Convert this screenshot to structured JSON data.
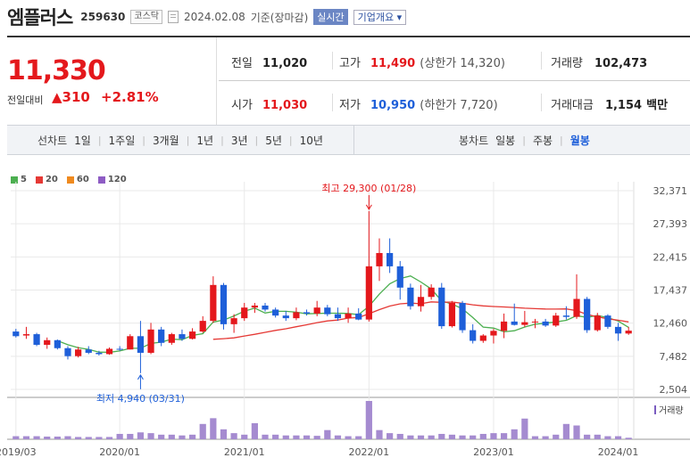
{
  "header": {
    "title": "엠플러스",
    "code": "259630",
    "market": "코스닥",
    "date": "2024.02.08",
    "basis": "기준(장마감)",
    "live_btn": "실시간",
    "info_btn": "기업개요 ▾"
  },
  "quote": {
    "price": "11,330",
    "change_label": "전일대비",
    "change": "▲310",
    "change_pct": "+2.81%",
    "prev_label": "전일",
    "prev": "11,020",
    "open_label": "시가",
    "open": "11,030",
    "high_label": "고가",
    "high": "11,490",
    "upper_limit": "(상한가 14,320)",
    "low_label": "저가",
    "low": "10,950",
    "lower_limit": "(하한가 7,720)",
    "volume_label": "거래량",
    "volume": "102,473",
    "amount_label": "거래대금",
    "amount": "1,154",
    "amount_unit": "백만"
  },
  "periods": {
    "line_label": "선차트",
    "line_items": [
      "1일",
      "1주일",
      "3개월",
      "1년",
      "3년",
      "5년",
      "10년"
    ],
    "candle_label": "봉차트",
    "candle_items": [
      "일봉",
      "주봉",
      "월봉"
    ],
    "candle_active": "월봉"
  },
  "colors": {
    "up": "#e4181c",
    "down": "#1e5fd9",
    "ma5": "#4caf50",
    "ma20": "#e53935",
    "ma60": "#ef8a1f",
    "ma120": "#8e5cc4"
  },
  "chart_data": {
    "type": "candlestick",
    "interval": "monthly",
    "legend": [
      {
        "name": "5",
        "color": "#4caf50"
      },
      {
        "name": "20",
        "color": "#e53935"
      },
      {
        "name": "60",
        "color": "#ef8a1f"
      },
      {
        "name": "120",
        "color": "#8e5cc4"
      }
    ],
    "y_ticks": [
      "32,371",
      "27,393",
      "22,415",
      "17,437",
      "12,460",
      "7,482",
      "2,504"
    ],
    "y_range": [
      2504,
      32371
    ],
    "x_ticks": [
      "2019/03",
      "2020/01",
      "2021/01",
      "2022/01",
      "2023/01",
      "2024/01"
    ],
    "annotations": {
      "max": {
        "text": "최고 29,300 (01/28)",
        "value": 29300,
        "date": "2022/01"
      },
      "min": {
        "text": "최저 4,940 (03/31)",
        "value": 4940,
        "date": "2020/03"
      }
    },
    "volume_label": "거래량",
    "candles": [
      {
        "d": "2019/03",
        "o": 11200,
        "h": 11600,
        "l": 10300,
        "c": 10500,
        "v": 8
      },
      {
        "d": "2019/04",
        "o": 10600,
        "h": 11900,
        "l": 10100,
        "c": 10800,
        "v": 8
      },
      {
        "d": "2019/05",
        "o": 10800,
        "h": 11000,
        "l": 9000,
        "c": 9200,
        "v": 8
      },
      {
        "d": "2019/06",
        "o": 9200,
        "h": 10300,
        "l": 8600,
        "c": 9900,
        "v": 7
      },
      {
        "d": "2019/07",
        "o": 9900,
        "h": 10000,
        "l": 8500,
        "c": 8700,
        "v": 7
      },
      {
        "d": "2019/08",
        "o": 8700,
        "h": 9000,
        "l": 7000,
        "c": 7500,
        "v": 8
      },
      {
        "d": "2019/09",
        "o": 7500,
        "h": 8900,
        "l": 7300,
        "c": 8500,
        "v": 6
      },
      {
        "d": "2019/10",
        "o": 8500,
        "h": 9000,
        "l": 7800,
        "c": 8000,
        "v": 6
      },
      {
        "d": "2019/11",
        "o": 8000,
        "h": 8300,
        "l": 7600,
        "c": 7800,
        "v": 6
      },
      {
        "d": "2019/12",
        "o": 7800,
        "h": 8800,
        "l": 7700,
        "c": 8600,
        "v": 6
      },
      {
        "d": "2020/01",
        "o": 8600,
        "h": 9000,
        "l": 8300,
        "c": 8500,
        "v": 14
      },
      {
        "d": "2020/02",
        "o": 8500,
        "h": 10800,
        "l": 8500,
        "c": 10500,
        "v": 14
      },
      {
        "d": "2020/03",
        "o": 10500,
        "h": 12800,
        "l": 4940,
        "c": 8000,
        "v": 18
      },
      {
        "d": "2020/04",
        "o": 8000,
        "h": 12500,
        "l": 7800,
        "c": 11500,
        "v": 16
      },
      {
        "d": "2020/05",
        "o": 11500,
        "h": 11900,
        "l": 9000,
        "c": 9500,
        "v": 12
      },
      {
        "d": "2020/06",
        "o": 9500,
        "h": 11000,
        "l": 9200,
        "c": 10800,
        "v": 12
      },
      {
        "d": "2020/07",
        "o": 10800,
        "h": 11500,
        "l": 9800,
        "c": 10100,
        "v": 10
      },
      {
        "d": "2020/08",
        "o": 10100,
        "h": 11700,
        "l": 10000,
        "c": 11200,
        "v": 12
      },
      {
        "d": "2020/09",
        "o": 11200,
        "h": 13500,
        "l": 11000,
        "c": 12800,
        "v": 40
      },
      {
        "d": "2020/10",
        "o": 12800,
        "h": 19500,
        "l": 12500,
        "c": 18200,
        "v": 55
      },
      {
        "d": "2020/11",
        "o": 18200,
        "h": 18500,
        "l": 11500,
        "c": 12300,
        "v": 26
      },
      {
        "d": "2020/12",
        "o": 12300,
        "h": 13800,
        "l": 11000,
        "c": 13200,
        "v": 16
      },
      {
        "d": "2021/01",
        "o": 13200,
        "h": 15500,
        "l": 12800,
        "c": 14800,
        "v": 12
      },
      {
        "d": "2021/02",
        "o": 14800,
        "h": 15500,
        "l": 14000,
        "c": 15100,
        "v": 42
      },
      {
        "d": "2021/03",
        "o": 15100,
        "h": 15500,
        "l": 14200,
        "c": 14500,
        "v": 12
      },
      {
        "d": "2021/04",
        "o": 14500,
        "h": 14800,
        "l": 13300,
        "c": 13600,
        "v": 12
      },
      {
        "d": "2021/05",
        "o": 13600,
        "h": 14300,
        "l": 12800,
        "c": 13200,
        "v": 10
      },
      {
        "d": "2021/06",
        "o": 13200,
        "h": 14800,
        "l": 12900,
        "c": 14100,
        "v": 10
      },
      {
        "d": "2021/07",
        "o": 14100,
        "h": 14500,
        "l": 13600,
        "c": 13900,
        "v": 10
      },
      {
        "d": "2021/08",
        "o": 13900,
        "h": 15800,
        "l": 13500,
        "c": 14800,
        "v": 9
      },
      {
        "d": "2021/09",
        "o": 14800,
        "h": 15200,
        "l": 13500,
        "c": 13800,
        "v": 24
      },
      {
        "d": "2021/10",
        "o": 13800,
        "h": 14800,
        "l": 12800,
        "c": 13200,
        "v": 10
      },
      {
        "d": "2021/11",
        "o": 13200,
        "h": 14800,
        "l": 12500,
        "c": 13900,
        "v": 8
      },
      {
        "d": "2021/12",
        "o": 13900,
        "h": 14700,
        "l": 12900,
        "c": 13000,
        "v": 8
      },
      {
        "d": "2022/01",
        "o": 13000,
        "h": 29300,
        "l": 12700,
        "c": 21000,
        "v": 100
      },
      {
        "d": "2022/02",
        "o": 21000,
        "h": 25200,
        "l": 18800,
        "c": 23000,
        "v": 24
      },
      {
        "d": "2022/03",
        "o": 23000,
        "h": 25200,
        "l": 20000,
        "c": 21000,
        "v": 16
      },
      {
        "d": "2022/04",
        "o": 21000,
        "h": 21800,
        "l": 16000,
        "c": 17800,
        "v": 14
      },
      {
        "d": "2022/05",
        "o": 17800,
        "h": 18400,
        "l": 14500,
        "c": 15000,
        "v": 10
      },
      {
        "d": "2022/06",
        "o": 15000,
        "h": 18200,
        "l": 14200,
        "c": 16400,
        "v": 10
      },
      {
        "d": "2022/07",
        "o": 16400,
        "h": 18300,
        "l": 16000,
        "c": 17800,
        "v": 10
      },
      {
        "d": "2022/08",
        "o": 17800,
        "h": 18500,
        "l": 11600,
        "c": 12000,
        "v": 14
      },
      {
        "d": "2022/09",
        "o": 12000,
        "h": 15800,
        "l": 11800,
        "c": 15500,
        "v": 12
      },
      {
        "d": "2022/10",
        "o": 15500,
        "h": 15800,
        "l": 11000,
        "c": 11400,
        "v": 10
      },
      {
        "d": "2022/11",
        "o": 11400,
        "h": 12300,
        "l": 9400,
        "c": 9800,
        "v": 10
      },
      {
        "d": "2022/12",
        "o": 9800,
        "h": 10800,
        "l": 9500,
        "c": 10600,
        "v": 14
      },
      {
        "d": "2023/01",
        "o": 10600,
        "h": 11600,
        "l": 9400,
        "c": 11300,
        "v": 16
      },
      {
        "d": "2023/02",
        "o": 11300,
        "h": 13900,
        "l": 10200,
        "c": 12700,
        "v": 16
      },
      {
        "d": "2023/03",
        "o": 12700,
        "h": 15400,
        "l": 12100,
        "c": 12200,
        "v": 26
      },
      {
        "d": "2023/04",
        "o": 12200,
        "h": 14300,
        "l": 11900,
        "c": 12600,
        "v": 54
      },
      {
        "d": "2023/05",
        "o": 12600,
        "h": 13100,
        "l": 11700,
        "c": 12700,
        "v": 8
      },
      {
        "d": "2023/06",
        "o": 12700,
        "h": 13100,
        "l": 11900,
        "c": 12100,
        "v": 8
      },
      {
        "d": "2023/07",
        "o": 12100,
        "h": 14000,
        "l": 11900,
        "c": 13600,
        "v": 12
      },
      {
        "d": "2023/08",
        "o": 13600,
        "h": 15000,
        "l": 13000,
        "c": 13400,
        "v": 40
      },
      {
        "d": "2023/09",
        "o": 13400,
        "h": 19800,
        "l": 13100,
        "c": 16100,
        "v": 36
      },
      {
        "d": "2023/10",
        "o": 16100,
        "h": 16400,
        "l": 11000,
        "c": 11400,
        "v": 12
      },
      {
        "d": "2023/11",
        "o": 11400,
        "h": 14000,
        "l": 11200,
        "c": 13600,
        "v": 12
      },
      {
        "d": "2023/12",
        "o": 13600,
        "h": 13800,
        "l": 11600,
        "c": 11900,
        "v": 8
      },
      {
        "d": "2024/01",
        "o": 11900,
        "h": 12500,
        "l": 9800,
        "c": 10900,
        "v": 8
      },
      {
        "d": "2024/02",
        "o": 10900,
        "h": 11900,
        "l": 10700,
        "c": 11330,
        "v": 4
      }
    ]
  }
}
